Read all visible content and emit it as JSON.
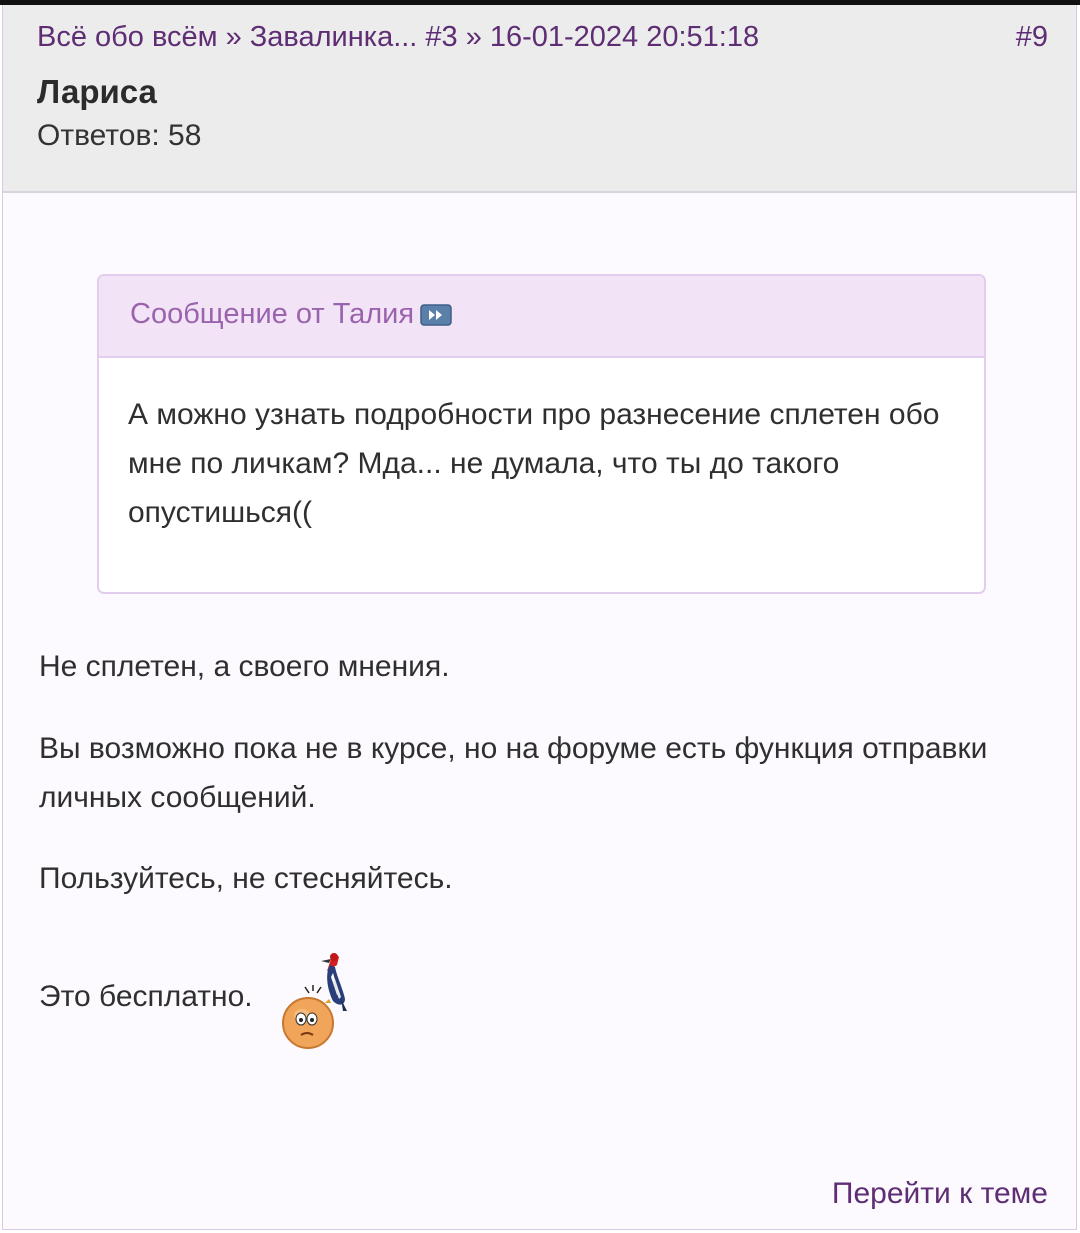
{
  "breadcrumb": {
    "forum": "Всё обо всём",
    "separator": "»",
    "topic": "Завалинка... #3",
    "datetime": "16-01-2024 20:51:18"
  },
  "post_number": "#9",
  "author": {
    "name": "Лариса",
    "replies": "Ответов: 58"
  },
  "quote": {
    "header": "Сообщение от Талия",
    "text": "А можно узнать подробности про разнесение сплетен обо мне по личкам? Мда... не думала, что ты до такого опустишься(("
  },
  "message": {
    "paragraphs": [
      "Не сплетен, а своего мнения.",
      "Вы возможно пока не в курсе, но на форуме есть функция отправки личных сообщений.",
      "Пользуйтесь, не стесняйтесь.",
      "Это бесплатно."
    ],
    "smiley_icon": "woodpecker-smiley-icon"
  },
  "footer": {
    "goto_link": "Перейти к теме"
  },
  "colors": {
    "link": "#5e2d73",
    "quote_header_bg": "#f3e3f6",
    "quote_header_text": "#9a63ae",
    "header_bg": "#ececec"
  }
}
